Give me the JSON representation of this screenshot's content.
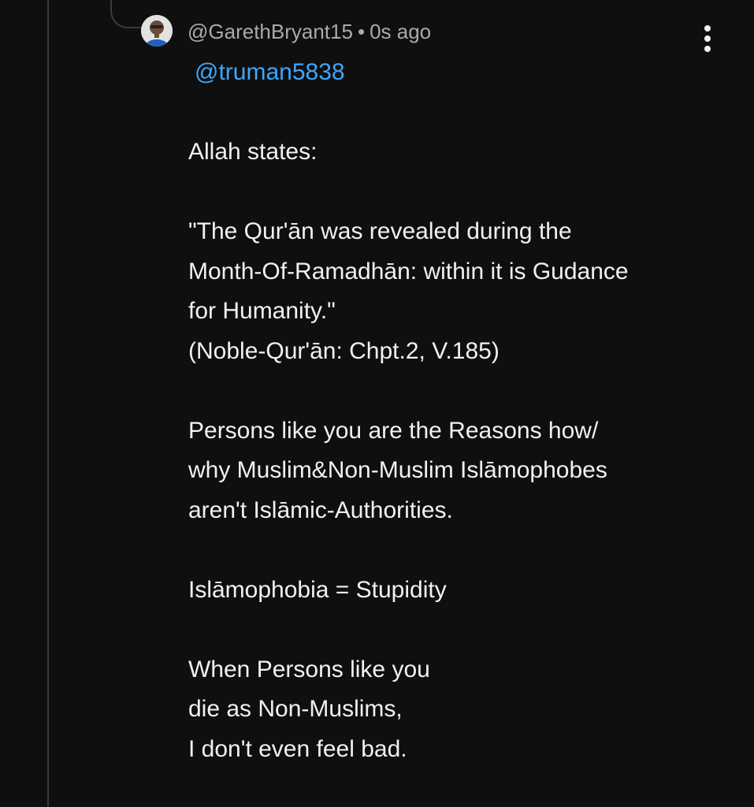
{
  "comment": {
    "author": "@GarethBryant15",
    "separator": "•",
    "timestamp": "0s ago",
    "mention": "@truman5838",
    "paragraphs": [
      "",
      "Allah states:",
      "",
      "\"The Qur'ān was revealed during the\nMonth-Of-Ramadhān: within it is Gudance\nfor Humanity.\"\n(Noble-Qur'ān: Chpt.2, V.185)",
      "",
      "Persons like you are the Reasons how/\nwhy Muslim&Non-Muslim Islāmophobes\naren't Islāmic-Authorities.",
      "",
      "Islāmophobia = Stupidity",
      "",
      "When Persons like you\ndie as Non-Muslims,\nI don't even feel bad."
    ]
  },
  "colors": {
    "background": "#0f0f0f",
    "text": "#f1f1f1",
    "meta": "#aaaaaa",
    "mention": "#3ea6ff",
    "thread_line": "#3a3a3a"
  },
  "icons": {
    "avatar": "avatar",
    "more": "kebab-menu-icon"
  }
}
